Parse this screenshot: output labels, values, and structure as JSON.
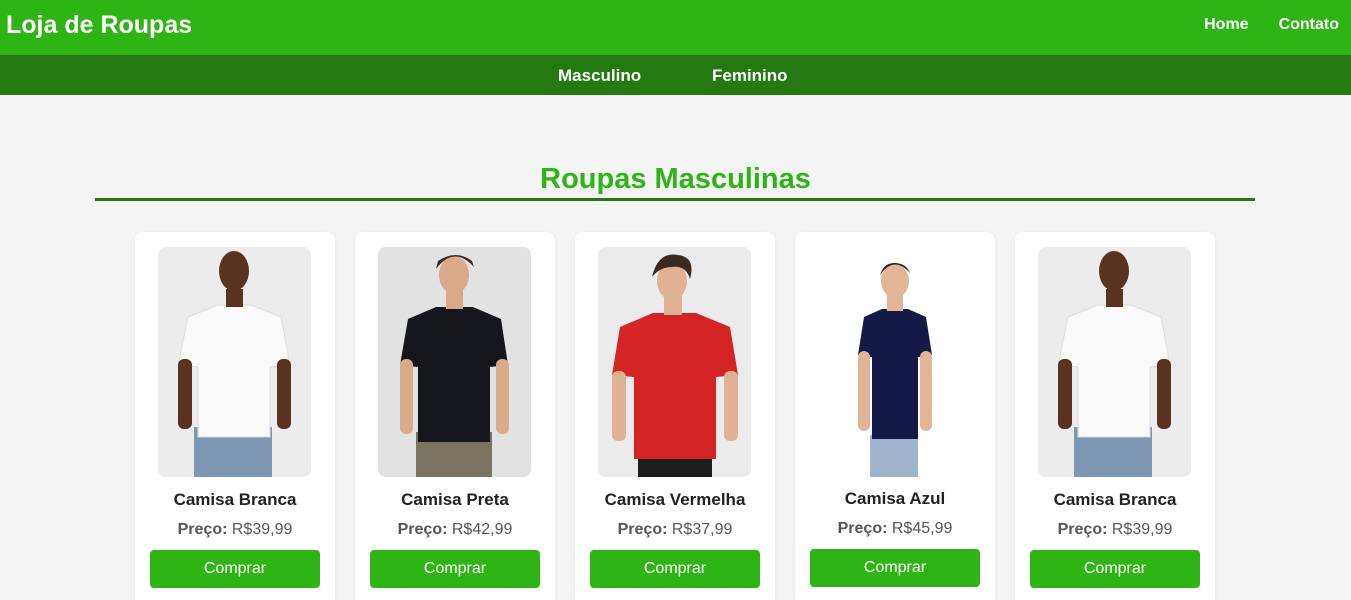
{
  "header": {
    "brand": "Loja de Roupas",
    "nav": [
      "Home",
      "Contato"
    ],
    "colors": {
      "primary": "#2fb415",
      "secondary": "#247a10"
    }
  },
  "categories": [
    "Masculino",
    "Feminino"
  ],
  "section": {
    "title": "Roupas Masculinas"
  },
  "products": [
    {
      "name": "Camisa Branca",
      "price_label": "Preço:",
      "price": "R$39,99",
      "button": "Comprar",
      "image": "white-tshirt-model"
    },
    {
      "name": "Camisa Preta",
      "price_label": "Preço:",
      "price": "R$42,99",
      "button": "Comprar",
      "image": "black-tshirt-model"
    },
    {
      "name": "Camisa Vermelha",
      "price_label": "Preço:",
      "price": "R$37,99",
      "button": "Comprar",
      "image": "red-tshirt-model"
    },
    {
      "name": "Camisa Azul",
      "price_label": "Preço:",
      "price": "R$45,99",
      "button": "Comprar",
      "image": "navy-tshirt-model"
    },
    {
      "name": "Camisa Branca",
      "price_label": "Preço:",
      "price": "R$39,99",
      "button": "Comprar",
      "image": "white-tshirt-model"
    }
  ]
}
